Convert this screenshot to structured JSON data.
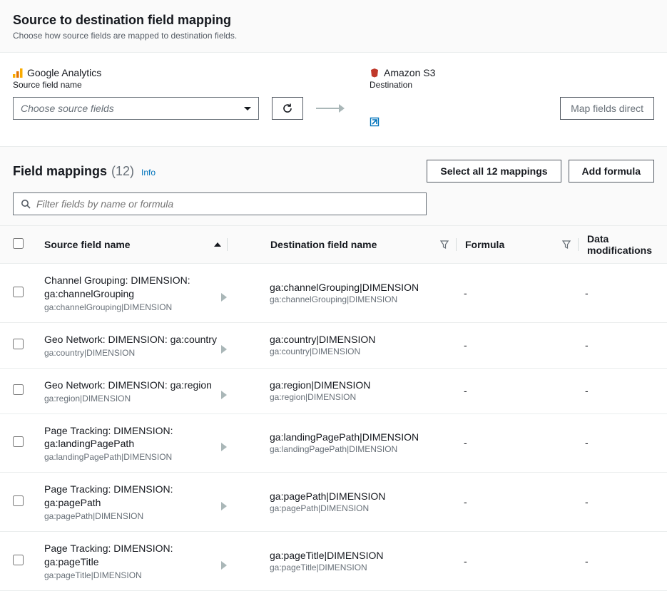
{
  "header": {
    "title": "Source to destination field mapping",
    "subtitle": "Choose how source fields are mapped to destination fields."
  },
  "source": {
    "name": "Google Analytics",
    "label": "Source field name",
    "select_placeholder": "Choose source fields"
  },
  "destination": {
    "name": "Amazon S3",
    "label": "Destination"
  },
  "map_direct_label": "Map fields direct",
  "mappings": {
    "title": "Field mappings",
    "count": "(12)",
    "info_label": "Info",
    "select_all_label": "Select all 12 mappings",
    "add_formula_label": "Add formula",
    "filter_placeholder": "Filter fields by name or formula",
    "columns": {
      "source": "Source field name",
      "destination": "Destination field name",
      "formula": "Formula",
      "modifications": "Data modifications"
    },
    "rows": [
      {
        "src_title": "Channel Grouping: DIMENSION: ga:channelGrouping",
        "src_sub": "ga:channelGrouping|DIMENSION",
        "dest_title": "ga:channelGrouping|DIMENSION",
        "dest_sub": "ga:channelGrouping|DIMENSION",
        "formula": "-",
        "mod": "-"
      },
      {
        "src_title": "Geo Network: DIMENSION: ga:country",
        "src_sub": "ga:country|DIMENSION",
        "dest_title": "ga:country|DIMENSION",
        "dest_sub": "ga:country|DIMENSION",
        "formula": "-",
        "mod": "-"
      },
      {
        "src_title": "Geo Network: DIMENSION: ga:region",
        "src_sub": "ga:region|DIMENSION",
        "dest_title": "ga:region|DIMENSION",
        "dest_sub": "ga:region|DIMENSION",
        "formula": "-",
        "mod": "-"
      },
      {
        "src_title": "Page Tracking: DIMENSION: ga:landingPagePath",
        "src_sub": "ga:landingPagePath|DIMENSION",
        "dest_title": "ga:landingPagePath|DIMENSION",
        "dest_sub": "ga:landingPagePath|DIMENSION",
        "formula": "-",
        "mod": "-"
      },
      {
        "src_title": "Page Tracking: DIMENSION: ga:pagePath",
        "src_sub": "ga:pagePath|DIMENSION",
        "dest_title": "ga:pagePath|DIMENSION",
        "dest_sub": "ga:pagePath|DIMENSION",
        "formula": "-",
        "mod": "-"
      },
      {
        "src_title": "Page Tracking: DIMENSION: ga:pageTitle",
        "src_sub": "ga:pageTitle|DIMENSION",
        "dest_title": "ga:pageTitle|DIMENSION",
        "dest_sub": "ga:pageTitle|DIMENSION",
        "formula": "-",
        "mod": "-"
      }
    ]
  }
}
